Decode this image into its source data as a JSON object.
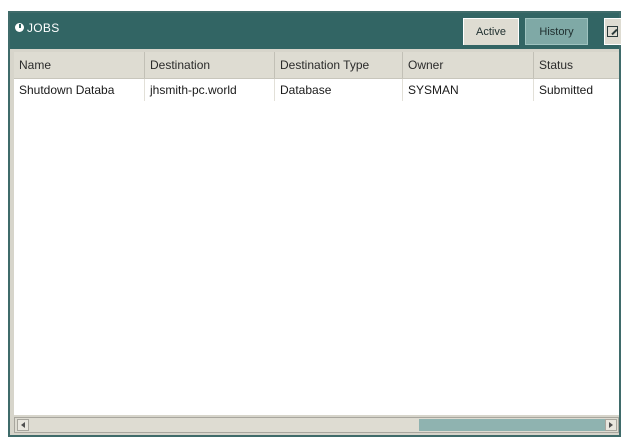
{
  "window": {
    "title": "JOBS"
  },
  "tabs": [
    {
      "label": "Active",
      "selected": true
    },
    {
      "label": "History",
      "selected": false
    }
  ],
  "icons": {
    "title": "clock-icon",
    "edit": "edit-icon",
    "scroll_left": "arrow-left-icon",
    "scroll_right": "arrow-right-icon"
  },
  "table": {
    "columns": [
      "Name",
      "Destination",
      "Destination Type",
      "Owner",
      "Status"
    ],
    "rows": [
      [
        "Shutdown Databa",
        "jhsmith-pc.world",
        "Database",
        "SYSMAN",
        "Submitted"
      ]
    ]
  },
  "colors": {
    "titlebar": "#326564",
    "tab_active": "#dedcd2",
    "tab_inactive": "#7fa9a6",
    "scroll_thumb": "#8fb3b0"
  }
}
